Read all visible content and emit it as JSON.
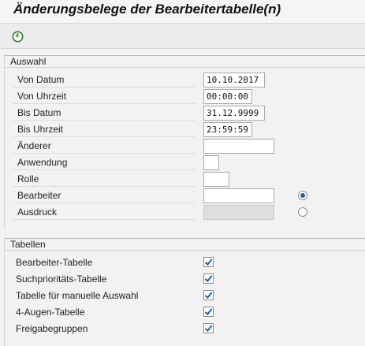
{
  "title": "Änderungsbelege der Bearbeitertabelle(n)",
  "toolbar": {
    "execute_icon": "execute-icon"
  },
  "auswahl": {
    "header": "Auswahl",
    "von_datum": {
      "label": "Von Datum",
      "value": "10.10.2017"
    },
    "von_uhrzeit": {
      "label": "Von Uhrzeit",
      "value": "00:00:00"
    },
    "bis_datum": {
      "label": "Bis Datum",
      "value": "31.12.9999"
    },
    "bis_uhrzeit": {
      "label": "Bis Uhrzeit",
      "value": "23:59:59"
    },
    "aenderer": {
      "label": "Änderer",
      "value": ""
    },
    "anwendung": {
      "label": "Anwendung",
      "value": ""
    },
    "rolle": {
      "label": "Rolle",
      "value": ""
    },
    "bearbeiter": {
      "label": "Bearbeiter",
      "value": "",
      "selected": true
    },
    "ausdruck": {
      "label": "Ausdruck",
      "value": "",
      "selected": false
    }
  },
  "tabellen": {
    "header": "Tabellen",
    "items": [
      {
        "label": "Bearbeiter-Tabelle",
        "checked": true
      },
      {
        "label": "Suchprioritäts-Tabelle",
        "checked": true
      },
      {
        "label": "Tabelle für manuelle Auswahl",
        "checked": true
      },
      {
        "label": "4-Augen-Tabelle",
        "checked": true
      },
      {
        "label": "Freigabegruppen",
        "checked": true
      }
    ]
  },
  "colors": {
    "check": "#1f5fae",
    "radio": "#1f5fae"
  }
}
